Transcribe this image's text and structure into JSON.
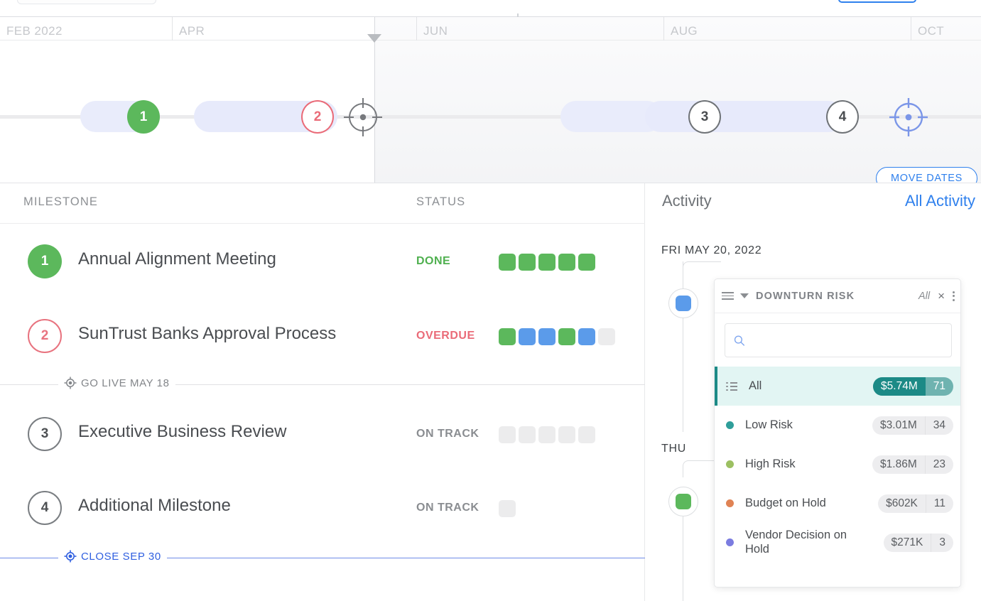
{
  "timeline": {
    "months": [
      "FEB 2022",
      "APR",
      "JUN",
      "AUG",
      "OCT"
    ],
    "move_dates_label": "MOVE DATES",
    "nodes": [
      {
        "label": "1",
        "style": "green"
      },
      {
        "label": "2",
        "style": "red"
      },
      {
        "label": "3",
        "style": "gray"
      },
      {
        "label": "4",
        "style": "gray"
      }
    ]
  },
  "milestone_table": {
    "headers": {
      "milestone": "MILESTONE",
      "status": "STATUS"
    },
    "rows": [
      {
        "number": "1",
        "badge_style": "green",
        "name": "Annual Alignment Meeting",
        "status": "DONE",
        "status_style": "done",
        "squares": [
          "g",
          "g",
          "g",
          "g",
          "g"
        ]
      },
      {
        "number": "2",
        "badge_style": "red",
        "name": "SunTrust Banks Approval Process",
        "status": "OVERDUE",
        "status_style": "overdue",
        "squares": [
          "g",
          "b",
          "b",
          "g",
          "b",
          "e"
        ]
      },
      {
        "number": "3",
        "badge_style": "gray",
        "name": "Executive Business Review",
        "status": "ON TRACK",
        "status_style": "ontrack",
        "squares": [
          "e",
          "e",
          "e",
          "e",
          "e"
        ]
      },
      {
        "number": "4",
        "badge_style": "gray",
        "name": "Additional Milestone",
        "status": "ON TRACK",
        "status_style": "ontrack",
        "squares": [
          "e"
        ]
      }
    ],
    "dividers": [
      {
        "label": "GO LIVE MAY 18",
        "style": "gray"
      },
      {
        "label": "CLOSE SEP 30",
        "style": "blue"
      }
    ]
  },
  "activity": {
    "title": "Activity",
    "all_activity_label": "All Activity",
    "entries": [
      {
        "date": "FRI MAY 20, 2022",
        "marker_color": "#5b9bea"
      },
      {
        "date": "THU",
        "marker_color": "#5cb85c"
      }
    ]
  },
  "dropdown": {
    "title": "DOWNTURN RISK",
    "all_label": "All",
    "close_label": "×",
    "search_value": "",
    "search_placeholder": "",
    "items": [
      {
        "label": "All",
        "amount": "$5.74M",
        "count": "71",
        "dot": "",
        "selected": true,
        "icon": "list-icon"
      },
      {
        "label": "Low Risk",
        "amount": "$3.01M",
        "count": "34",
        "dot": "#2f9e9a",
        "selected": false
      },
      {
        "label": "High Risk",
        "amount": "$1.86M",
        "count": "23",
        "dot": "#9cc062",
        "selected": false
      },
      {
        "label": "Budget on Hold",
        "amount": "$602K",
        "count": "11",
        "dot": "#e08354",
        "selected": false
      },
      {
        "label": "Vendor Decision on Hold",
        "amount": "$271K",
        "count": "3",
        "dot": "#7b7ce0",
        "selected": false
      }
    ]
  }
}
